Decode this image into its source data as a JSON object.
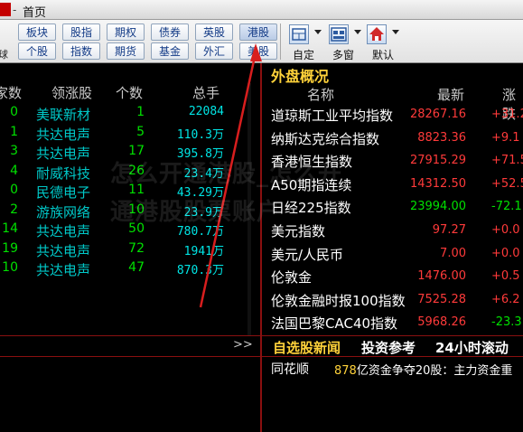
{
  "titlebar": {
    "separator": "-",
    "title": "首页"
  },
  "toolbar": {
    "row1_left_cut": "",
    "row2_left_cut": "球",
    "row1": [
      "板块",
      "股指",
      "期权",
      "债券",
      "英股",
      "港股"
    ],
    "row2": [
      "个股",
      "指数",
      "期货",
      "基金",
      "外汇",
      "美股"
    ],
    "selected": "港股",
    "tools": [
      {
        "icon": "layout-grid-icon",
        "label": "自定"
      },
      {
        "icon": "multi-window-icon",
        "label": "多窗"
      },
      {
        "icon": "home-icon",
        "label": "默认"
      }
    ]
  },
  "left_table": {
    "headers": [
      "家数",
      "领涨股",
      "个数",
      "总手"
    ],
    "rows": [
      {
        "count": "0",
        "leader": "美联新材",
        "num": "1",
        "hands": "22084",
        "unit": ""
      },
      {
        "count": "1",
        "leader": "共达电声",
        "num": "5",
        "hands": "110.3",
        "unit": "万"
      },
      {
        "count": "3",
        "leader": "共达电声",
        "num": "17",
        "hands": "395.8",
        "unit": "万"
      },
      {
        "count": "4",
        "leader": "耐威科技",
        "num": "26",
        "hands": "23.4",
        "unit": "万"
      },
      {
        "count": "0",
        "leader": "民德电子",
        "num": "11",
        "hands": "43.29",
        "unit": "万"
      },
      {
        "count": "2",
        "leader": "游族网络",
        "num": "10",
        "hands": "23.9",
        "unit": "万"
      },
      {
        "count": "14",
        "leader": "共达电声",
        "num": "50",
        "hands": "780.7",
        "unit": "万"
      },
      {
        "count": "19",
        "leader": "共达电声",
        "num": "72",
        "hands": "1941",
        "unit": "万"
      },
      {
        "count": "10",
        "leader": "共达电声",
        "num": "47",
        "hands": "870.3",
        "unit": "万"
      }
    ]
  },
  "right_panel": {
    "title": "外盘概况",
    "headers": [
      "名称",
      "最新",
      "涨跌"
    ],
    "rows": [
      {
        "name": "道琼斯工业平均指数",
        "latest": "28267.16",
        "change": "+31.2",
        "up": true
      },
      {
        "name": "纳斯达克综合指数",
        "latest": "8823.36",
        "change": "+9.1",
        "up": true
      },
      {
        "name": "香港恒生指数",
        "latest": "27915.29",
        "change": "+71.5",
        "up": true
      },
      {
        "name": "A50期指连续",
        "latest": "14312.50",
        "change": "+52.5",
        "up": true
      },
      {
        "name": "日经225指数",
        "latest": "23994.00",
        "change": "-72.1",
        "up": false
      },
      {
        "name": "美元指数",
        "latest": "97.27",
        "change": "+0.0",
        "up": true
      },
      {
        "name": "美元/人民币",
        "latest": "7.00",
        "change": "+0.0",
        "up": true
      },
      {
        "name": "伦敦金",
        "latest": "1476.00",
        "change": "+0.5",
        "up": true
      },
      {
        "name": "伦敦金融时报100指数",
        "latest": "7525.28",
        "change": "+6.2",
        "up": true
      },
      {
        "name": "法国巴黎CAC40指数",
        "latest": "5968.26",
        "change": "-23.3",
        "up": false
      }
    ]
  },
  "news": {
    "more": ">>",
    "tabs": [
      "自选股新闻",
      "投资参考",
      "24小时滚动"
    ],
    "source": "同花顺",
    "number": "878",
    "text": "亿资金争夺20股：主力资金重"
  },
  "watermark": {
    "line1": "怎么开通港股_怎么开",
    "line2": "通港股股票账户"
  },
  "colors": {
    "up": "#ff3a3a",
    "down": "#00e000",
    "accent": "#ffd23a",
    "divider": "#8a1010"
  }
}
